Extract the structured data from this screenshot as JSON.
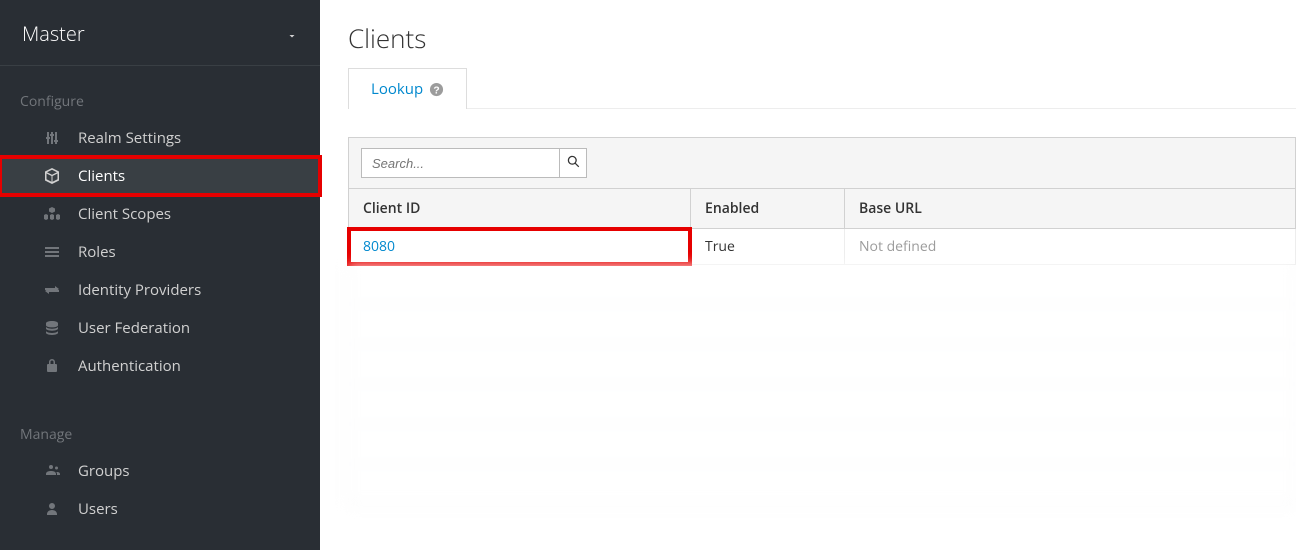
{
  "realm": {
    "name": "Master"
  },
  "sidebar": {
    "configure_label": "Configure",
    "manage_label": "Manage",
    "configure_items": [
      {
        "label": "Realm Settings"
      },
      {
        "label": "Clients"
      },
      {
        "label": "Client Scopes"
      },
      {
        "label": "Roles"
      },
      {
        "label": "Identity Providers"
      },
      {
        "label": "User Federation"
      },
      {
        "label": "Authentication"
      }
    ],
    "manage_items": [
      {
        "label": "Groups"
      },
      {
        "label": "Users"
      }
    ]
  },
  "page": {
    "title": "Clients"
  },
  "tabs": {
    "lookup": "Lookup"
  },
  "search": {
    "placeholder": "Search..."
  },
  "table": {
    "headers": {
      "client_id": "Client ID",
      "enabled": "Enabled",
      "base_url": "Base URL"
    },
    "rows": [
      {
        "client_id": "8080",
        "enabled": "True",
        "base_url": "Not defined"
      }
    ]
  }
}
